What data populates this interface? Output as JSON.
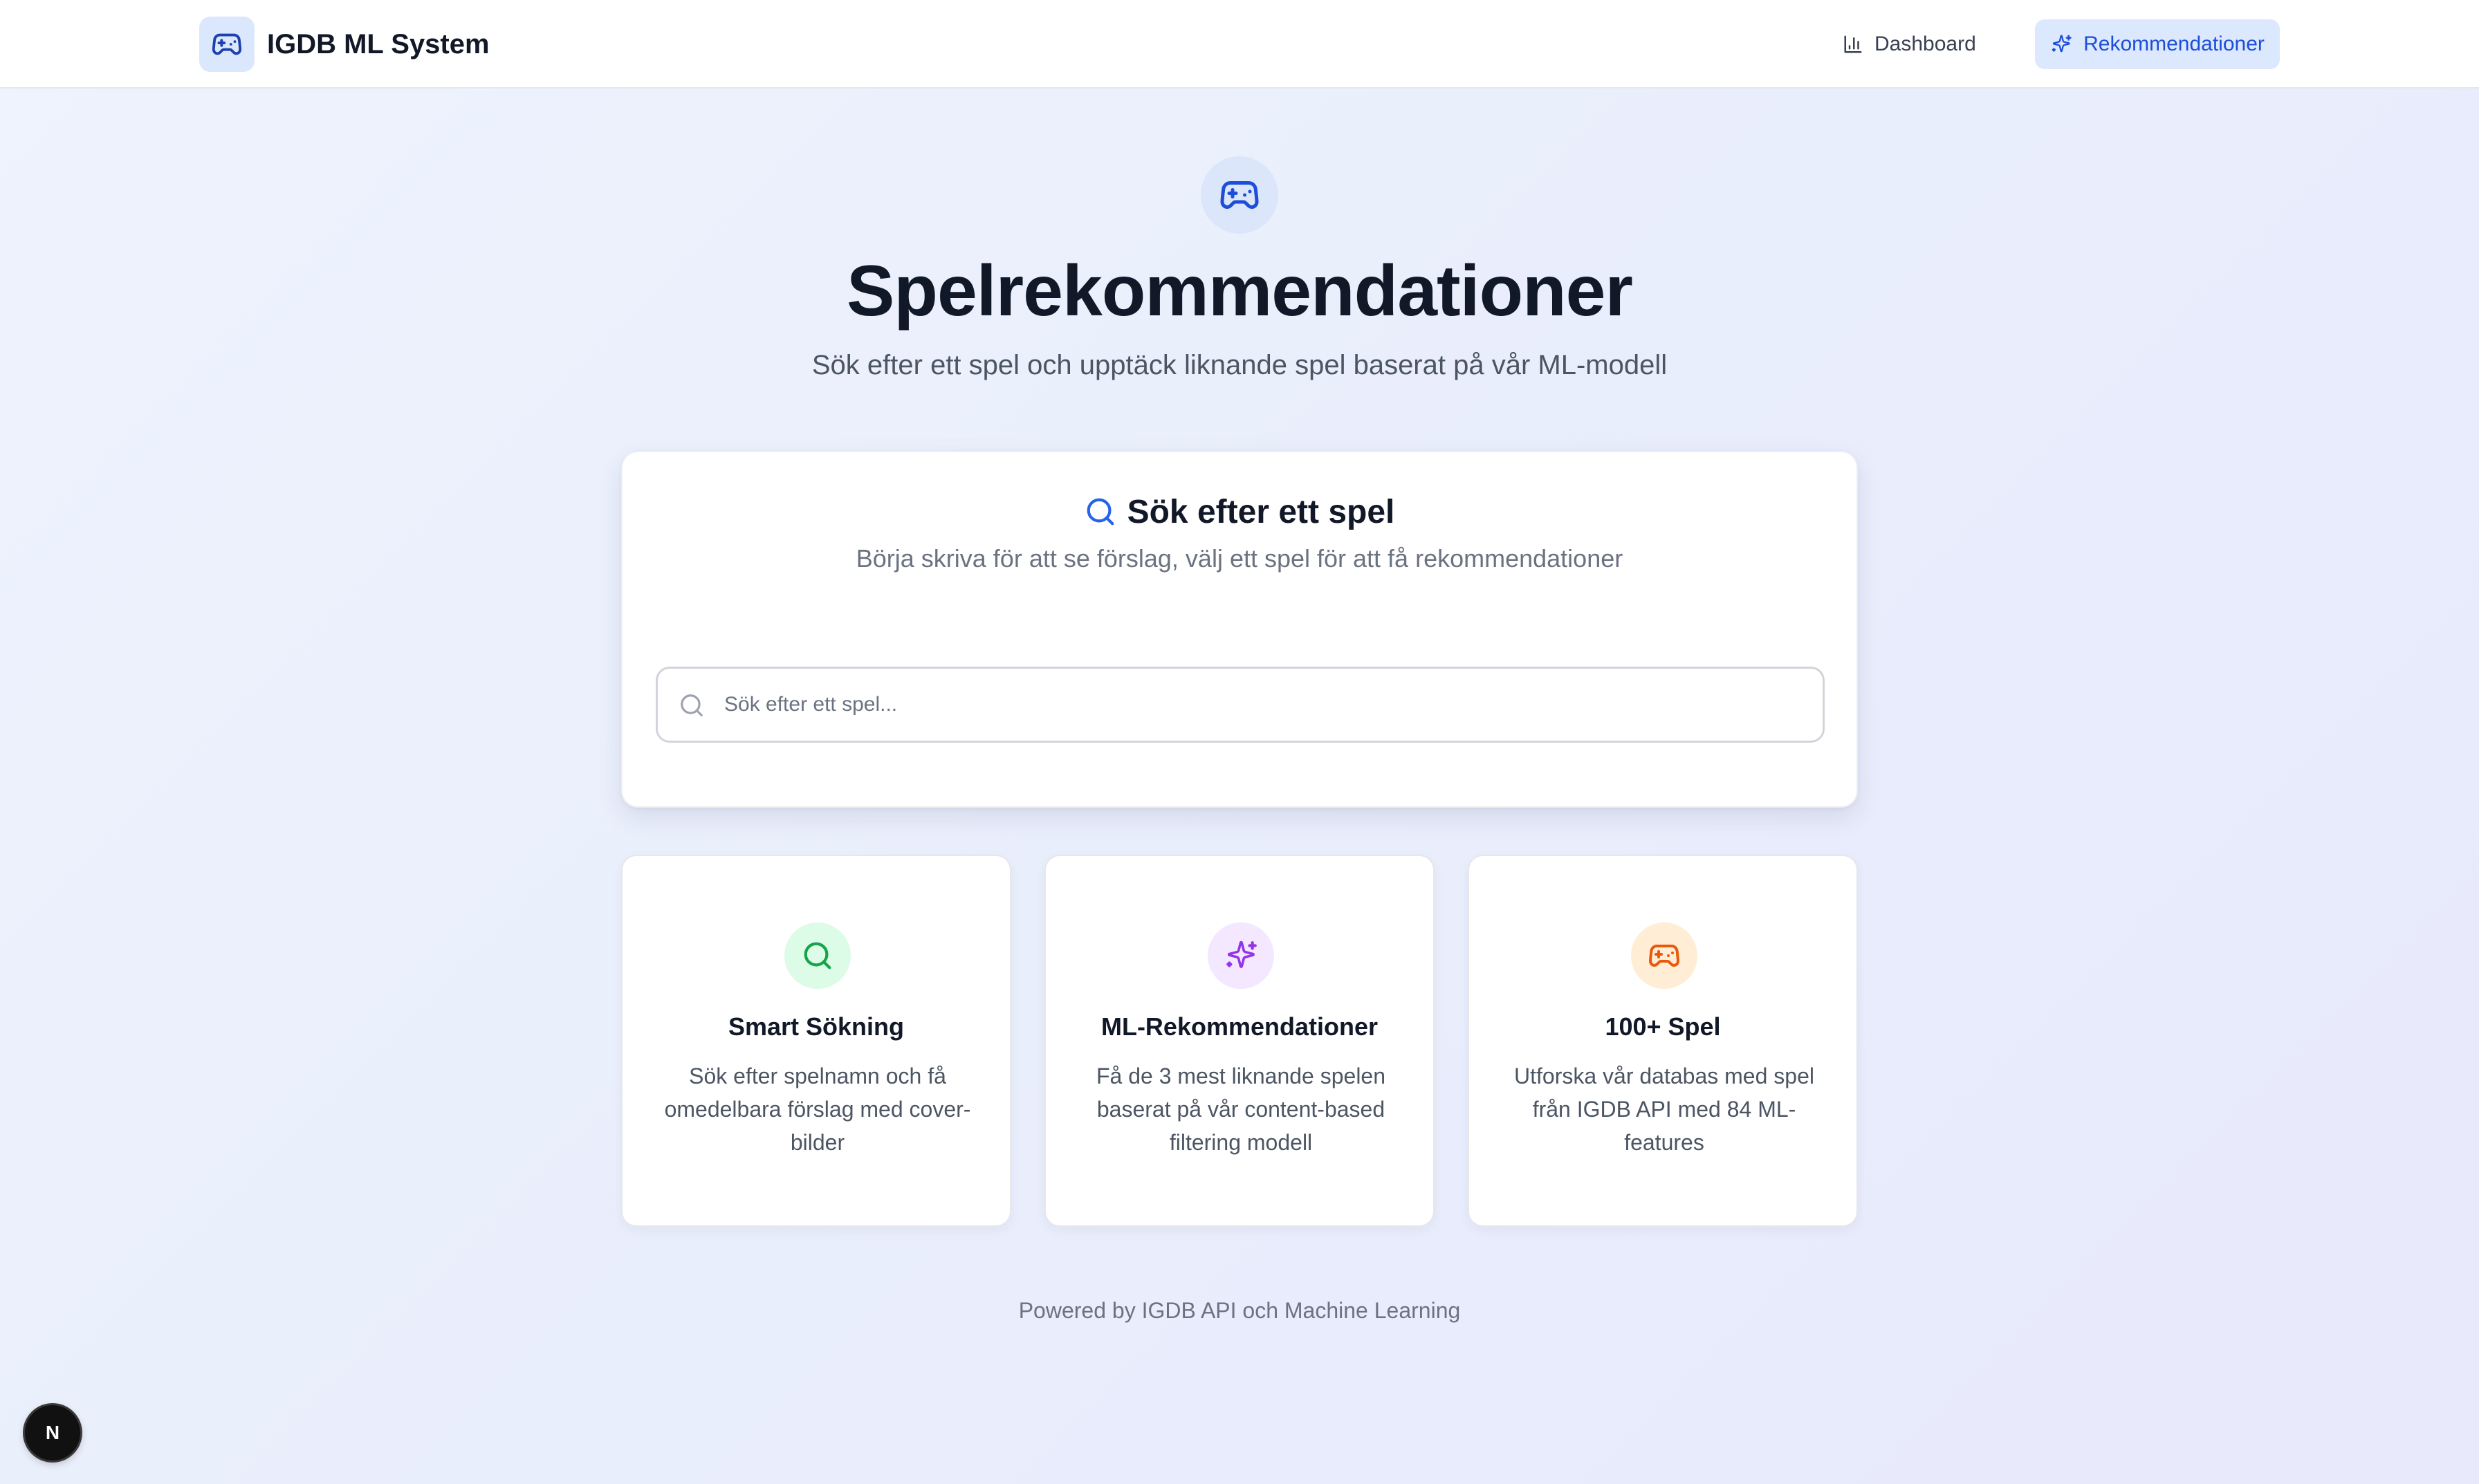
{
  "app": {
    "title": "IGDB ML System",
    "icon": "gamepad-icon"
  },
  "nav": {
    "items": [
      {
        "label": "Dashboard",
        "icon": "bar-chart-icon",
        "active": false
      },
      {
        "label": "Rekommendationer",
        "icon": "sparkles-icon",
        "active": true
      }
    ]
  },
  "hero": {
    "icon": "gamepad-icon",
    "title": "Spelrekommendationer",
    "subtitle": "Sök efter ett spel och upptäck liknande spel baserat på vår ML-modell"
  },
  "search": {
    "icon": "search-icon",
    "title": "Sök efter ett spel",
    "description": "Börja skriva för att se förslag, välj ett spel för att få rekommendationer",
    "value": "",
    "placeholder": "Sök efter ett spel..."
  },
  "features": [
    {
      "icon": "search-icon",
      "title": "Smart Sökning",
      "description": "Sök efter spelnamn och få omedelbara förslag med cover-bilder"
    },
    {
      "icon": "sparkles-icon",
      "title": "ML-Rekommendationer",
      "description": "Få de 3 mest liknande spelen baserat på vår content-based filtering modell"
    },
    {
      "icon": "gamepad-icon",
      "title": "100+ Spel",
      "description": "Utforska vår databas med spel från IGDB API med 84 ML-features"
    }
  ],
  "footer": {
    "text": "Powered by IGDB API och Machine Learning"
  },
  "dev_badge": {
    "letter": "N"
  },
  "colors": {
    "primary": "#2563eb",
    "active_nav_bg": "#dbe8fd",
    "green_accent": "#16a34a",
    "purple_accent": "#9333ea",
    "orange_accent": "#ea580c"
  }
}
